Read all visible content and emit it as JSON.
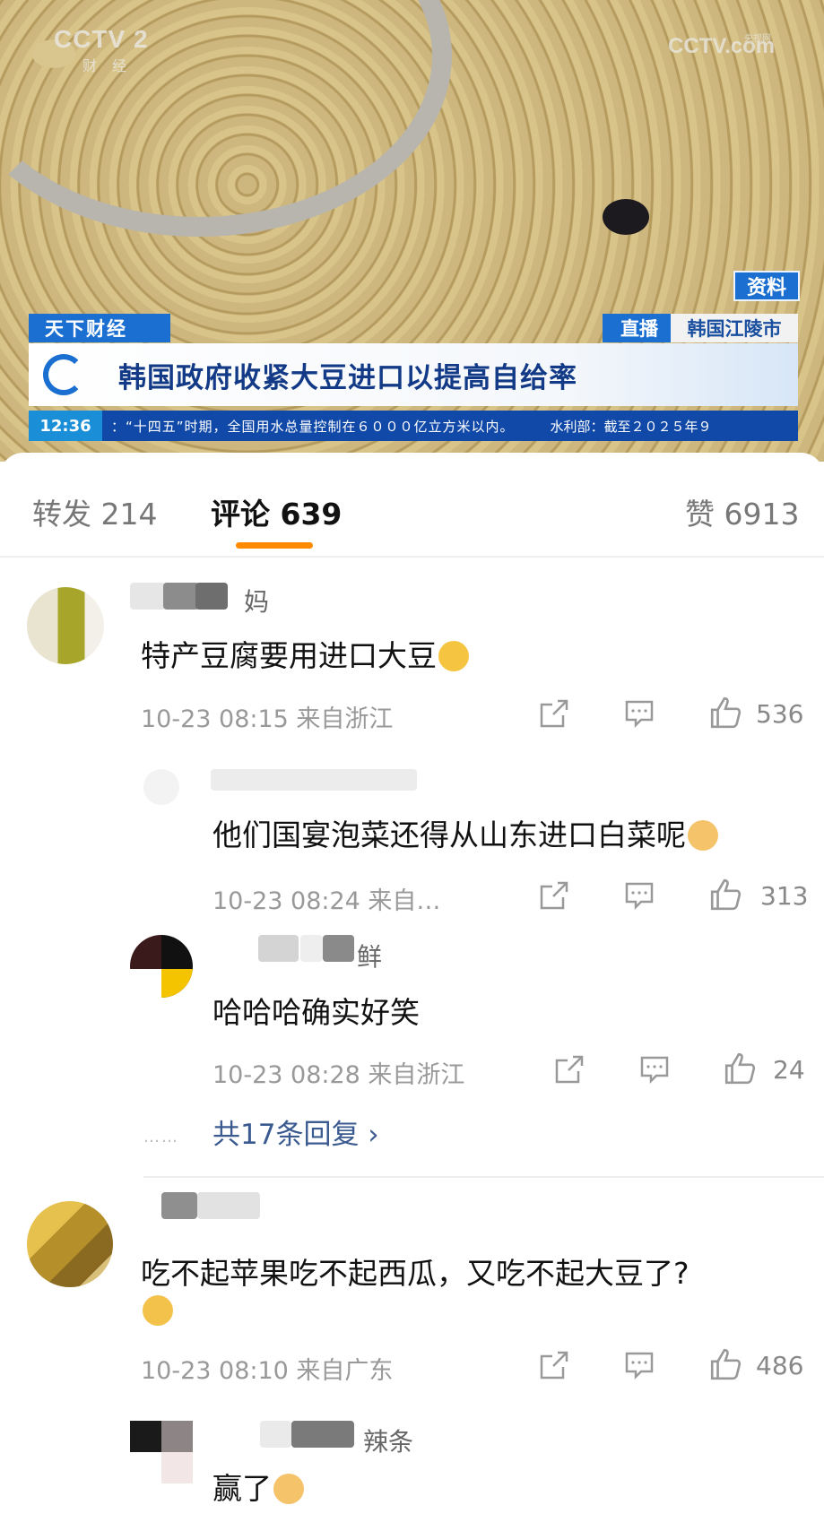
{
  "video": {
    "channel_logo": "CCTV 2",
    "channel_sub": "财 经",
    "watermark": "CCTV.com",
    "watermark_small": "央视网",
    "tag_ziliao": "资料",
    "program": "天下财经",
    "live_tag": "直播",
    "location": "韩国江陵市",
    "headline": "韩国政府收紧大豆进口以提高自给率",
    "ticker_time": "12:36",
    "ticker_text": "：“十四五”时期，全国用水总量控制在６０００亿立方米以内。",
    "ticker_right": "水利部：截至２０２５年９"
  },
  "tabs": {
    "repost": "转发 214",
    "comments": "评论 639",
    "likes": "赞 6913"
  },
  "comments": [
    {
      "name_tail": "妈",
      "text": "特产豆腐要用进口大豆",
      "emoji": "crying-face-emoji",
      "meta": "10-23 08:15 来自浙江",
      "likes": "536",
      "replies": [
        {
          "name_tail": "",
          "text": "他们国宴泡菜还得从山东进口白菜呢",
          "emoji": "doge-emoji",
          "meta": "10-23 08:24 来自…",
          "likes": "313"
        },
        {
          "name_tail": "鲜",
          "text": "哈哈哈确实好笑",
          "meta": "10-23 08:28 来自浙江",
          "likes": "24"
        }
      ],
      "more_replies": "共17条回复 ›"
    },
    {
      "name_tail": "",
      "text": "吃不起苹果吃不起西瓜，又吃不起大豆了?",
      "emoji": "thinking-face-emoji",
      "meta": "10-23 08:10 来自广东",
      "likes": "486",
      "replies": [
        {
          "name_tail": "辣条",
          "text": "赢了",
          "emoji": "doge-emoji"
        }
      ]
    }
  ],
  "colors": {
    "accent": "#ff8a00",
    "cctv_blue": "#1b6fd0",
    "link": "#3a5a90"
  }
}
